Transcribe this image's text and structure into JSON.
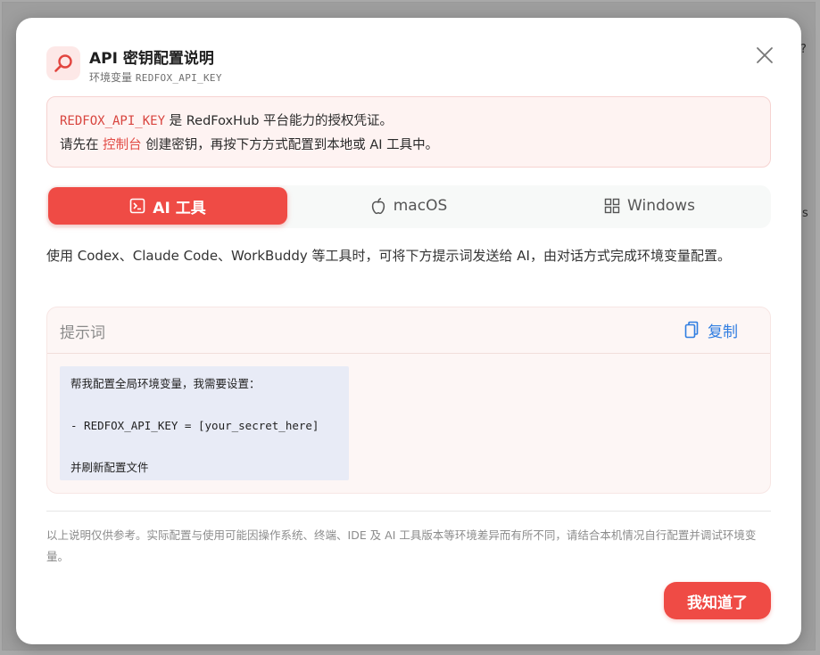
{
  "dialog": {
    "title": "API 密钥配置说明",
    "subtitle_prefix": "环境变量",
    "subtitle_var": "REDFOX_API_KEY"
  },
  "notice": {
    "line1_var": "REDFOX_API_KEY",
    "line1_text": " 是 RedFoxHub 平台能力的授权凭证。",
    "line2_prefix": "请先在 ",
    "line2_link": "控制台",
    "line2_suffix": " 创建密钥，再按下方方式配置到本地或 AI 工具中。"
  },
  "tabs": [
    {
      "label": "AI 工具",
      "icon": "terminal-icon",
      "active": true
    },
    {
      "label": "macOS",
      "icon": "apple-icon",
      "active": false
    },
    {
      "label": "Windows",
      "icon": "windows-icon",
      "active": false
    }
  ],
  "description": "使用 Codex、Claude Code、WorkBuddy 等工具时，可将下方提示词发送给 AI，由对话方式完成环境变量配置。",
  "prompt": {
    "label": "提示词",
    "copy_label": "复制",
    "code": "帮我配置全局环境变量，我需要设置：\n\n- REDFOX_API_KEY = [your_secret_here]\n\n并刷新配置文件"
  },
  "disclaimer": "以上说明仅供参考。实际配置与使用可能因操作系统、终端、IDE 及 AI 工具版本等环境差异而有所不同，请结合本机情况自行配置并调试环境变量。",
  "confirm_button": "我知道了",
  "background_glyphs": [
    "?",
    "s"
  ],
  "colors": {
    "accent": "#ef4b45",
    "link": "#2f7de1",
    "notice_bg": "#fef3f2",
    "code_bg": "#e8ebf6"
  }
}
